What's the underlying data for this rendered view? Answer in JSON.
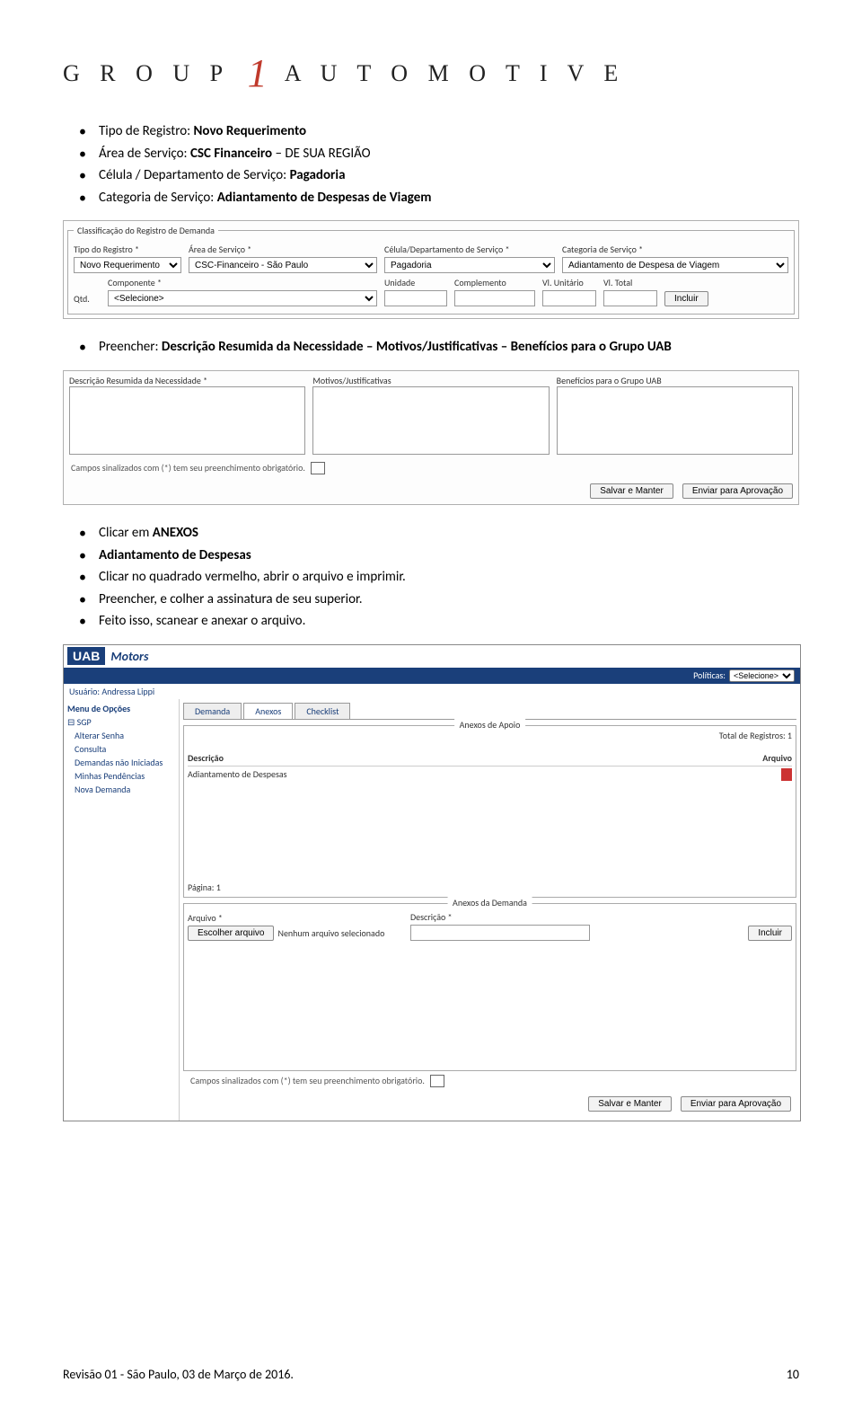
{
  "logo": {
    "g": "G R O U P",
    "one": "1",
    "a": "A U T O M O T I V E"
  },
  "bullets1": [
    {
      "pre": "Tipo de Registro: ",
      "b": "Novo Requerimento"
    },
    {
      "pre": "Área de Serviço: ",
      "b": "CSC Financeiro",
      "post": " – DE SUA REGIÃO"
    },
    {
      "pre": "Célula / Departamento de Serviço: ",
      "b": "Pagadoria"
    },
    {
      "pre": "Categoria de Serviço: ",
      "b": "Adiantamento de Despesas de Viagem"
    }
  ],
  "shot1": {
    "legend": "Classificação do Registro de Demanda",
    "labels": {
      "tipo": "Tipo do Registro *",
      "area": "Área de Serviço *",
      "celula": "Célula/Departamento de Serviço *",
      "categ": "Categoria de Serviço *",
      "qtd": "Qtd.",
      "comp": "Componente *",
      "unidade": "Unidade",
      "compl": "Complemento",
      "vlu": "Vl. Unitário",
      "vlt": "Vl. Total"
    },
    "values": {
      "tipo": "Novo Requerimento",
      "area": "CSC-Financeiro - São Paulo",
      "celula": "Pagadoria",
      "categ": "Adiantamento de Despesa de Viagem",
      "comp": "<Selecione>"
    },
    "incluir": "Incluir"
  },
  "bullets2": [
    {
      "pre": "Preencher: ",
      "b": "Descrição Resumida da Necessidade – Motivos/Justificativas – Benefícios para o Grupo UAB"
    }
  ],
  "shot2": {
    "c1": "Descrição Resumida da Necessidade *",
    "c2": "Motivos/Justificativas",
    "c3": "Benefícios para o Grupo UAB",
    "note": "Campos sinalizados com (*) tem seu preenchimento obrigatório.",
    "b1": "Salvar e Manter",
    "b2": "Enviar para Aprovação"
  },
  "bullets3": [
    {
      "pre": "Clicar em ",
      "b": "ANEXOS"
    },
    {
      "b": "Adiantamento de Despesas"
    },
    {
      "pre": "Clicar no quadrado vermelho, abrir o arquivo e imprimir."
    },
    {
      "pre": "Preencher, e colher a assinatura de seu superior."
    },
    {
      "pre": "Feito isso, scanear e anexar o arquivo."
    }
  ],
  "uab": {
    "logoU": "UAB",
    "logoM": "Motors",
    "userlabel": "Usuário:",
    "user": "Andressa Lippi",
    "politicas": "Políticas:",
    "sel": "<Selecione>",
    "menuTitle": "Menu de Opções",
    "menuRoot": "SGP",
    "menuItems": [
      "Alterar Senha",
      "Consulta",
      "Demandas não Iniciadas",
      "Minhas Pendências",
      "Nova Demanda"
    ],
    "tabs": [
      "Demanda",
      "Anexos",
      "Checklist"
    ],
    "fs1": "Anexos de Apoio",
    "total": "Total de Registros: 1",
    "desc": "Descrição",
    "arq": "Arquivo",
    "rowdesc": "Adiantamento de Despesas",
    "pagina": "Página: 1",
    "fs2": "Anexos da Demanda",
    "arql": "Arquivo *",
    "descl": "Descrição *",
    "escolher": "Escolher arquivo",
    "nenhum": "Nenhum arquivo selecionado",
    "incluir": "Incluir",
    "note": "Campos sinalizados com (*) tem seu preenchimento obrigatório.",
    "b1": "Salvar e Manter",
    "b2": "Enviar para Aprovação"
  },
  "footer": {
    "left": "Revisão 01 - São Paulo, 03 de Março de 2016.",
    "right": "10"
  }
}
